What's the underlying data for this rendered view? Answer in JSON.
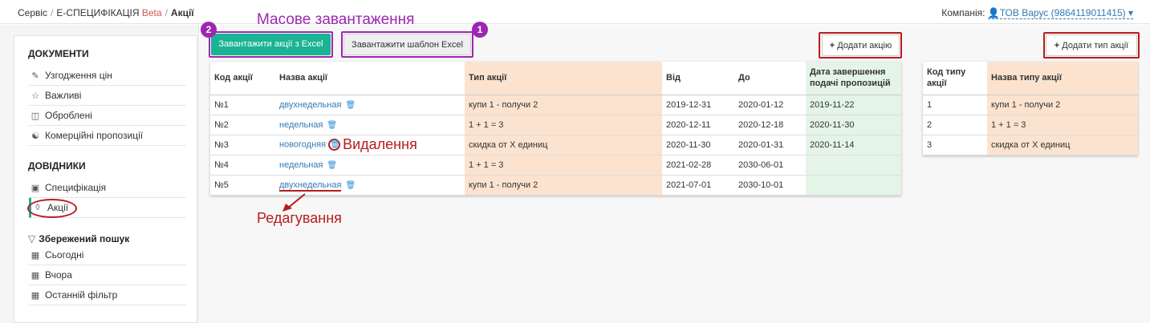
{
  "breadcrumb": {
    "item1": "Сервіс",
    "item2": "Е-СПЕЦИФІКАЦІЯ",
    "beta": "Beta",
    "current": "Акції",
    "separator": "/"
  },
  "company": {
    "label": "Компанія:",
    "value": "ТОВ Варус (9864119011415)"
  },
  "sidebar": {
    "documents_title": "ДОКУМЕНТИ",
    "documents": [
      {
        "label": "Узгодження цін",
        "icon": "document-edit-icon"
      },
      {
        "label": "Важливі",
        "icon": "star-icon"
      },
      {
        "label": "Оброблені",
        "icon": "inbox-icon"
      },
      {
        "label": "Комерційні пропозиції",
        "icon": "handshake-icon"
      }
    ],
    "directories_title": "ДОВІДНИКИ",
    "directories": [
      {
        "label": "Специфікація",
        "icon": "boxes-icon"
      },
      {
        "label": "Акції",
        "icon": "tag-icon"
      }
    ],
    "saved_search_title": "Збережений пошук",
    "saved_searches": [
      {
        "label": "Сьогодні",
        "icon": "file-icon"
      },
      {
        "label": "Вчора",
        "icon": "file-icon"
      },
      {
        "label": "Останній фільтр",
        "icon": "file-icon"
      }
    ]
  },
  "toolbar": {
    "upload_excel": "Завантажити акції з Excel",
    "download_template": "Завантажити шаблон Excel",
    "add_promo": "Додати акцію",
    "add_promo_type": "Додати тип акції"
  },
  "annotations": {
    "bulk_upload": "Масове завантаження",
    "delete": "Видалення",
    "edit": "Редагування",
    "badge1": "1",
    "badge2": "2"
  },
  "promo_table": {
    "headers": [
      "Код акції",
      "Назва акції",
      "Тип акції",
      "Від",
      "До",
      "Дата завершення подачі пропозицій"
    ],
    "rows": [
      {
        "code": "№1",
        "name": "двухнедельная",
        "type": "купи 1 - получи 2",
        "from": "2019-12-31",
        "to": "2020-01-12",
        "deadline": "2019-11-22"
      },
      {
        "code": "№2",
        "name": "недельная",
        "type": "1 + 1 = 3",
        "from": "2020-12-11",
        "to": "2020-12-18",
        "deadline": "2020-11-30"
      },
      {
        "code": "№3",
        "name": "новогодняя",
        "type": "скидка от X единиц",
        "from": "2020-11-30",
        "to": "2020-01-31",
        "deadline": "2020-11-14"
      },
      {
        "code": "№4",
        "name": "недельная",
        "type": "1 + 1 = 3",
        "from": "2021-02-28",
        "to": "2030-06-01",
        "deadline": ""
      },
      {
        "code": "№5",
        "name": "двухнедельная",
        "type": "купи 1 - получи 2",
        "from": "2021-07-01",
        "to": "2030-10-01",
        "deadline": ""
      }
    ]
  },
  "type_table": {
    "headers": [
      "Код типу акції",
      "Назва типу акції"
    ],
    "rows": [
      {
        "code": "1",
        "name": "купи 1 - получи 2"
      },
      {
        "code": "2",
        "name": "1 + 1 = 3"
      },
      {
        "code": "3",
        "name": "скидка от X единиц"
      }
    ]
  },
  "colors": {
    "accent_green": "#1ab394",
    "annotation_purple": "#9c27b0",
    "annotation_red": "#b71c1c",
    "header_peach": "#fbe3cf",
    "header_mint": "#e4f4e6",
    "link_blue": "#337ab7"
  }
}
